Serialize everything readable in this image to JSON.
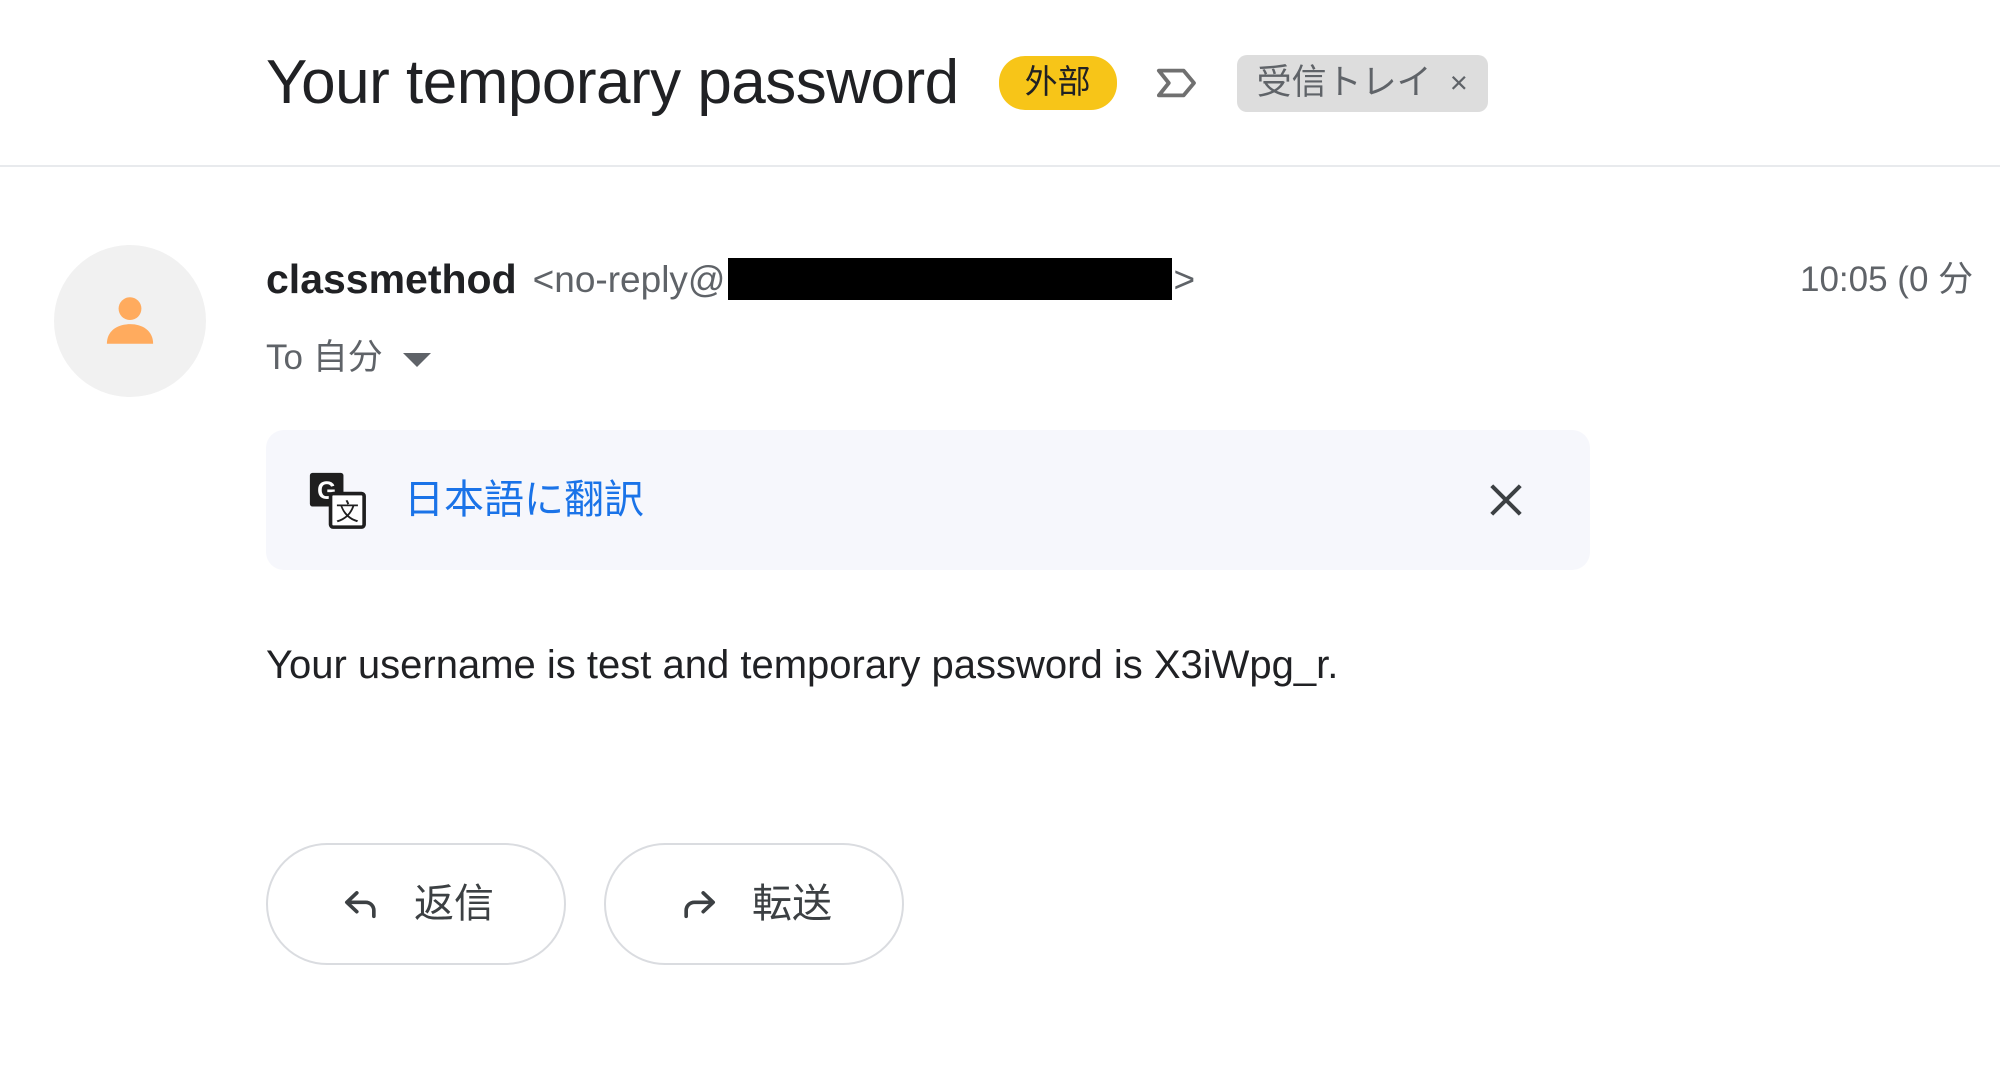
{
  "header": {
    "subject": "Your temporary password",
    "external_badge": "外部",
    "important_marker_icon": "important-chevron-icon",
    "inbox_chip": {
      "label": "受信トレイ",
      "close": "×"
    }
  },
  "message": {
    "avatar_icon": "person-avatar-icon",
    "sender_name": "classmethod",
    "sender_email_prefix": "<no-reply@",
    "sender_email_suffix": ">",
    "sender_email_redacted": true,
    "recipient": "To 自分",
    "recipient_caret_icon": "chevron-down-icon",
    "timestamp": "10:05 (0 分"
  },
  "translate_banner": {
    "icon": "google-translate-icon",
    "icon_letter": "G",
    "icon_glyph": "文",
    "link_label": "日本語に翻訳",
    "close_icon": "close-icon",
    "background_color": "#F6F7FC",
    "link_color": "#1A73E8"
  },
  "body": {
    "text": "Your username is test and temporary password is X3iWpg_r."
  },
  "actions": [
    {
      "label": "返信",
      "icon": "reply-arrow-icon"
    },
    {
      "label": "転送",
      "icon": "forward-arrow-icon"
    }
  ],
  "colors": {
    "external_badge": "#F7C518",
    "inbox_chip": "#DDDDDD",
    "avatar_bg": "#F1F1F1",
    "avatar_fg": "#FFAB5E",
    "text_primary": "#202124",
    "text_secondary": "#5F6368",
    "divider": "#E8EAED"
  }
}
